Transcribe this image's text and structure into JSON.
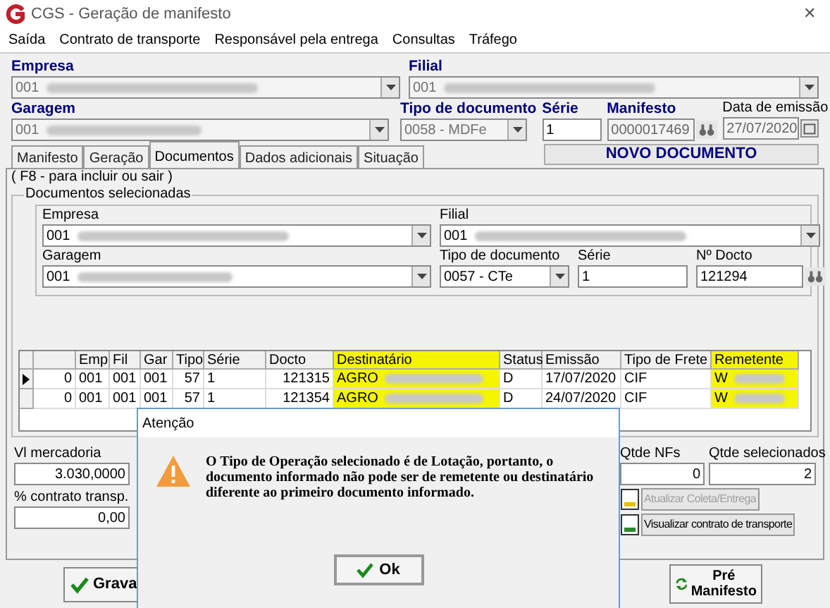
{
  "window": {
    "title": "CGS - Geração de manifesto",
    "close": "✕"
  },
  "menu": [
    "Saída",
    "Contrato de transporte",
    "Responsável pela entrega",
    "Consultas",
    "Tráfego"
  ],
  "header": {
    "empresa": {
      "label": "Empresa",
      "value": "001",
      "redacted": true,
      "disabled": true
    },
    "filial": {
      "label": "Filial",
      "value": "001",
      "redacted": true,
      "disabled": true
    },
    "garagem": {
      "label": "Garagem",
      "value": "001",
      "redacted": true,
      "disabled": true
    },
    "tipo_documento": {
      "label": "Tipo de documento",
      "value": "0058 - MDFe",
      "disabled": true
    },
    "serie": {
      "label": "Série",
      "value": "1",
      "disabled": false
    },
    "manifesto": {
      "label": "Manifesto",
      "value": "0000017469",
      "disabled": true
    },
    "data_emissao": {
      "label": "Data de emissão",
      "value": "27/07/2020",
      "disabled": true
    }
  },
  "tabs": [
    {
      "label": "Manifesto",
      "selected": false
    },
    {
      "label": "Geração",
      "selected": false
    },
    {
      "label": "Documentos",
      "selected": true
    },
    {
      "label": "Dados adicionais",
      "selected": false
    },
    {
      "label": "Situação",
      "selected": false
    }
  ],
  "status": "NOVO DOCUMENTO",
  "hint": "( F8 - para incluir ou sair )",
  "group": {
    "title": "Documentos selecionadas",
    "empresa": {
      "label": "Empresa",
      "value": "001",
      "redacted": true
    },
    "filial": {
      "label": "Filial",
      "value": "001",
      "redacted": true
    },
    "garagem": {
      "label": "Garagem",
      "value": "001",
      "redacted": true
    },
    "tipo_documento": {
      "label": "Tipo de documento",
      "value": "0057 - CTe"
    },
    "serie": {
      "label": "Série",
      "value": "1"
    },
    "docto": {
      "label": "Nº Docto",
      "value": "121294"
    }
  },
  "grid": {
    "columns": [
      {
        "highlighted": false
      },
      {
        "label": "Emp",
        "highlighted": false
      },
      {
        "label": "Fil",
        "highlighted": false
      },
      {
        "label": "Gar",
        "highlighted": false
      },
      {
        "label": "Tipo",
        "highlighted": false
      },
      {
        "label": "Série",
        "highlighted": false
      },
      {
        "label": "Docto",
        "highlighted": false
      },
      {
        "label": "Destinatário",
        "highlighted": true
      },
      {
        "label": "Status",
        "highlighted": false
      },
      {
        "label": "Emissão",
        "highlighted": false
      },
      {
        "label": "Tipo de Frete",
        "highlighted": false
      },
      {
        "label": "Remetente",
        "highlighted": true
      }
    ],
    "rows": [
      {
        "selected": true,
        "cells": [
          "0",
          "001",
          "001",
          "001",
          "57",
          "1",
          "121315",
          "AGRO",
          "D",
          "17/07/2020",
          "CIF",
          "W"
        ]
      },
      {
        "selected": false,
        "cells": [
          "0",
          "001",
          "001",
          "001",
          "57",
          "1",
          "121354",
          "AGRO",
          "D",
          "24/07/2020",
          "CIF",
          "W"
        ]
      }
    ]
  },
  "totals": {
    "vl_mercadoria": {
      "label": "Vl mercadoria",
      "value": "3.030,0000"
    },
    "contrato": {
      "label": "% contrato transp.",
      "value": "0,00"
    },
    "qtde_nfs": {
      "label": "Qtde NFs",
      "value": "0"
    },
    "qtde_selecionados": {
      "label": "Qtde selecionados",
      "value": "2"
    }
  },
  "actions": [
    {
      "label": "Atualizar Coleta/Entrega",
      "disabled": true
    },
    {
      "label": "Visualizar contrato de transporte",
      "disabled": false
    }
  ],
  "footer": {
    "save": "Grava",
    "pre": [
      "Pré",
      "Manifesto"
    ]
  },
  "dialog": {
    "title": "Atenção",
    "message": "O Tipo de Operação selecionado é de Lotação, portanto, o documento informado não pode ser de remetente ou destinatário diferente ao primeiro documento informado.",
    "button": "Ok"
  }
}
